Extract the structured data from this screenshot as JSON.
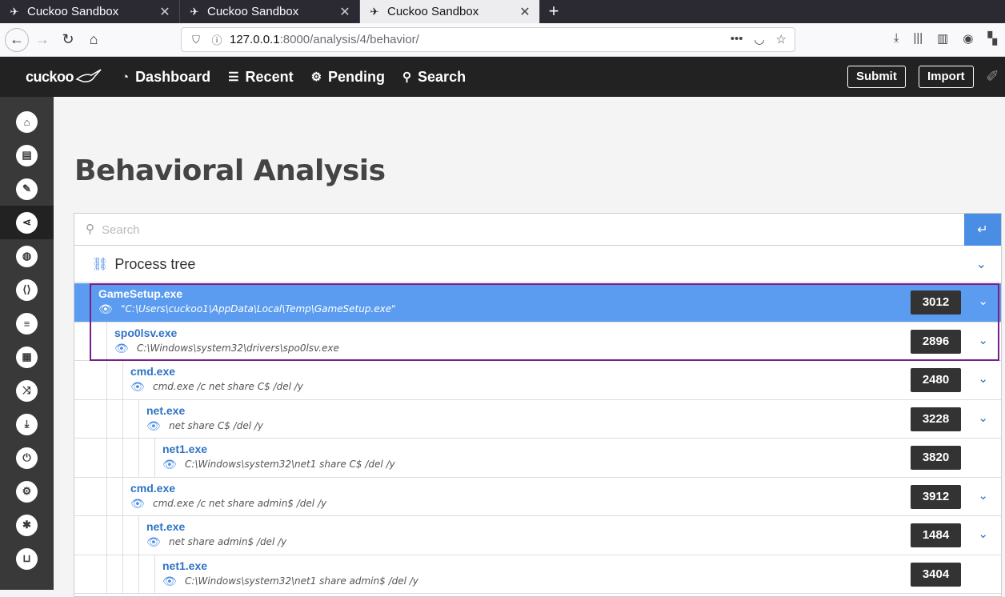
{
  "browser": {
    "tabs": [
      {
        "title": "Cuckoo Sandbox",
        "active": false
      },
      {
        "title": "Cuckoo Sandbox",
        "active": false
      },
      {
        "title": "Cuckoo Sandbox",
        "active": true
      }
    ],
    "url_host": "127.0.0.1",
    "url_path": ":8000/analysis/4/behavior/"
  },
  "header": {
    "logo": "cuckoo",
    "nav": [
      {
        "label": "Dashboard",
        "icon": "dashboard-icon"
      },
      {
        "label": "Recent",
        "icon": "list-icon"
      },
      {
        "label": "Pending",
        "icon": "cogs-icon"
      },
      {
        "label": "Search",
        "icon": "search-icon"
      }
    ],
    "submit_label": "Submit",
    "import_label": "Import"
  },
  "sidebar": {
    "items": [
      {
        "name": "home-icon",
        "glyph": "⌂"
      },
      {
        "name": "book-icon",
        "glyph": "▤"
      },
      {
        "name": "pencil-icon",
        "glyph": "✎"
      },
      {
        "name": "share-icon",
        "glyph": "⋖",
        "active": true
      },
      {
        "name": "globe-icon",
        "glyph": "◍"
      },
      {
        "name": "file-code-icon",
        "glyph": "⟨⟩"
      },
      {
        "name": "server-icon",
        "glyph": "≡"
      },
      {
        "name": "qrcode-icon",
        "glyph": "▦"
      },
      {
        "name": "random-icon",
        "glyph": "⤨"
      },
      {
        "name": "download-icon",
        "glyph": "⤓"
      },
      {
        "name": "power-icon",
        "glyph": "⏻"
      },
      {
        "name": "cogs-icon",
        "glyph": "⚙"
      },
      {
        "name": "bug-icon",
        "glyph": "✱"
      },
      {
        "name": "unlock-icon",
        "glyph": "⊔"
      }
    ]
  },
  "main": {
    "title": "Behavioral Analysis",
    "search_placeholder": "Search",
    "process_tree_label": "Process tree",
    "processes": [
      {
        "name": "GameSetup.exe",
        "cmd": "\"C:\\Users\\cuckoo1\\AppData\\Local\\Temp\\GameSetup.exe\"",
        "pid": "3012",
        "depth": 0,
        "expandable": true,
        "selected": true
      },
      {
        "name": "spo0lsv.exe",
        "cmd": "C:\\Windows\\system32\\drivers\\spo0lsv.exe",
        "pid": "2896",
        "depth": 1,
        "expandable": true
      },
      {
        "name": "cmd.exe",
        "cmd": "cmd.exe /c net share C$ /del /y",
        "pid": "2480",
        "depth": 2,
        "expandable": true
      },
      {
        "name": "net.exe",
        "cmd": "net share C$ /del /y",
        "pid": "3228",
        "depth": 3,
        "expandable": true
      },
      {
        "name": "net1.exe",
        "cmd": "C:\\Windows\\system32\\net1 share C$ /del /y",
        "pid": "3820",
        "depth": 4,
        "expandable": false
      },
      {
        "name": "cmd.exe",
        "cmd": "cmd.exe /c net share admin$ /del /y",
        "pid": "3912",
        "depth": 2,
        "expandable": true
      },
      {
        "name": "net.exe",
        "cmd": "net share admin$ /del /y",
        "pid": "1484",
        "depth": 3,
        "expandable": true
      },
      {
        "name": "net1.exe",
        "cmd": "C:\\Windows\\system32\\net1 share admin$ /del /y",
        "pid": "3404",
        "depth": 4,
        "expandable": false
      }
    ]
  },
  "colors": {
    "accent": "#4a8de4",
    "selected_row": "#5b9cf0",
    "highlight_border": "#7a1d8c",
    "header_bg": "#222222",
    "sidebar_bg": "#393939"
  }
}
